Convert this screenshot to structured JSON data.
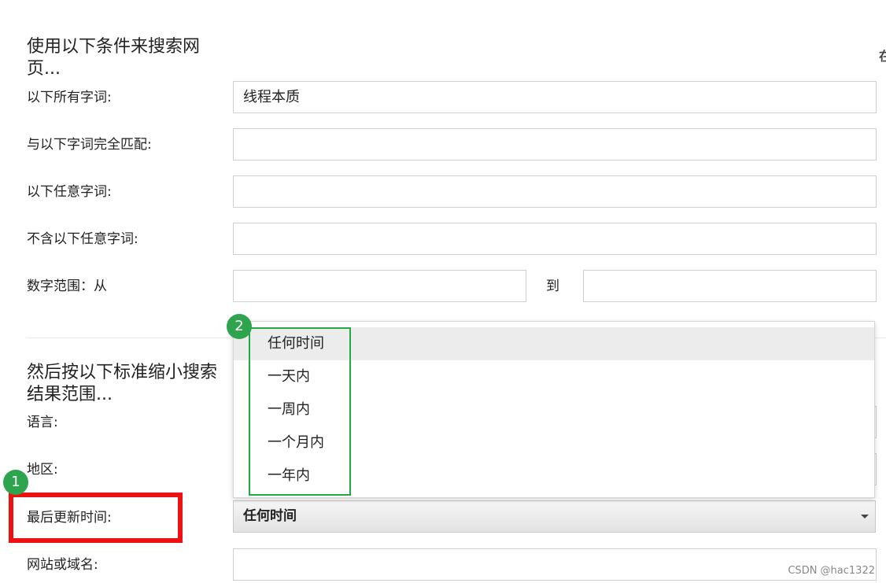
{
  "section1": {
    "heading": "使用以下条件来搜索网页..."
  },
  "fields": {
    "all_words": {
      "label": "以下所有字词:",
      "value": "线程本质"
    },
    "exact_phrase": {
      "label": "与以下字词完全匹配:",
      "value": ""
    },
    "any_words": {
      "label": "以下任意字词:",
      "value": ""
    },
    "none_words": {
      "label": "不含以下任意字词:",
      "value": ""
    },
    "number_range": {
      "label": "数字范围：从",
      "to_label": "到",
      "from_value": "",
      "to_value": ""
    }
  },
  "section2": {
    "heading": "然后按以下标准缩小搜索结果范围..."
  },
  "language": {
    "label": "语言:"
  },
  "region": {
    "label": "地区:"
  },
  "last_update": {
    "label": "最后更新时间:",
    "selected": "任何时间",
    "options": [
      "任何时间",
      "一天内",
      "一周内",
      "一个月内",
      "一年内"
    ]
  },
  "site": {
    "label": "网站或域名:",
    "value": ""
  },
  "annotations": {
    "badge1": "1",
    "badge2": "2"
  },
  "watermark": "CSDN @hac1322",
  "edge_glyph": "在",
  "colors": {
    "highlight_red": "#ee1111",
    "highlight_green": "#22aa44",
    "badge_green": "#2ea44f"
  }
}
